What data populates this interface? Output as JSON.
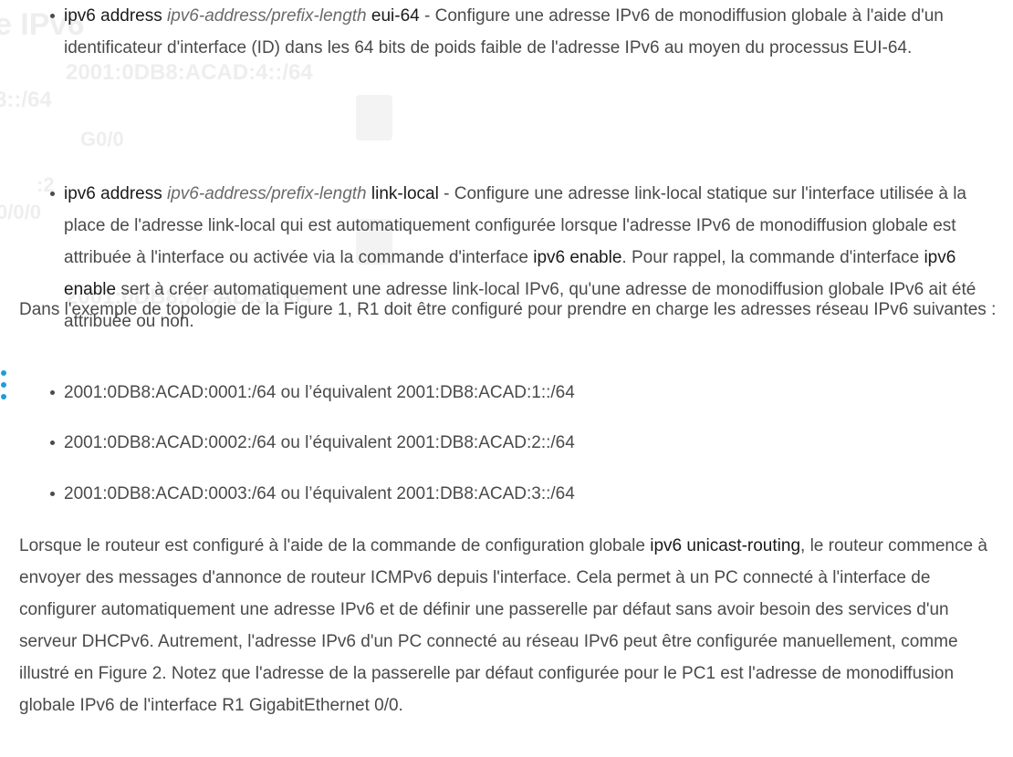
{
  "background_figure": {
    "title_fragment": "e IPv6",
    "network_1": "2001:0DB8:ACAD:4::/64",
    "network_2": "8::/64",
    "interface_g00": "G0/0",
    "host_2": ":2",
    "interface_000": "0/0/0",
    "network_5": "2001:0DB8:ACAD:5::/64"
  },
  "bullets": [
    {
      "command": "ipv6 address",
      "argument": "ipv6-address/prefix-length",
      "keyword": "eui-64",
      "description": " - Configure une adresse IPv6 de monodiffusion globale à l'aide d'un identificateur d'interface (ID) dans les 64 bits de poids faible de l'adresse IPv6 au moyen du processus EUI-64."
    },
    {
      "command": "ipv6 address",
      "argument": "ipv6-address/prefix-length",
      "keyword": "link-local",
      "description_before": " - Configure une adresse link-local statique sur l'interface utilisée à la place de l'adresse link-local qui est automatiquement configurée lorsque l'adresse IPv6 de monodiffusion globale est attribuée à l'interface ou activée via la commande d'interface ",
      "cmd_enable_1": "ipv6 enable",
      "description_middle": ". Pour rappel, la commande d'interface ",
      "cmd_enable_2": "ipv6 enable",
      "description_after": " sert à créer automatiquement une adresse link-local IPv6, qu'une adresse de monodiffusion globale IPv6 ait été attribuée ou non."
    }
  ],
  "paragraph_1": "Dans l'exemple de topologie de la Figure 1, R1 doit être configuré pour prendre en charge les adresses réseau IPv6 suivantes :",
  "networks": [
    "2001:0DB8:ACAD:0001:/64 ou l’équivalent 2001:DB8:ACAD:1::/64",
    "2001:0DB8:ACAD:0002:/64 ou l’équivalent 2001:DB8:ACAD:2::/64",
    "2001:0DB8:ACAD:0003:/64 ou l’équivalent 2001:DB8:ACAD:3::/64"
  ],
  "paragraph_2": {
    "before": "Lorsque le routeur est configuré à l'aide de la commande de configuration globale ",
    "command": "ipv6 unicast-routing",
    "after": ", le routeur commence à envoyer des messages d'annonce de routeur ICMPv6 depuis l'interface. Cela permet à un PC connecté à l'interface de configurer automatiquement une adresse IPv6 et de définir une passerelle par défaut sans avoir besoin des services d'un serveur DHCPv6. Autrement, l'adresse IPv6 d'un PC connecté au réseau IPv6 peut être configurée manuellement, comme illustré en Figure 2. Notez que l'adresse de la passerelle par défaut configurée pour le PC1 est l'adresse de monodiffusion globale IPv6 de l'interface R1 GigabitEthernet 0/0."
  },
  "side_menu_icon": "vertical-dots-icon",
  "colors": {
    "text": "#4a4a4a",
    "command_text": "#1a1a1a",
    "accent_dots": "#1a9fd9"
  }
}
